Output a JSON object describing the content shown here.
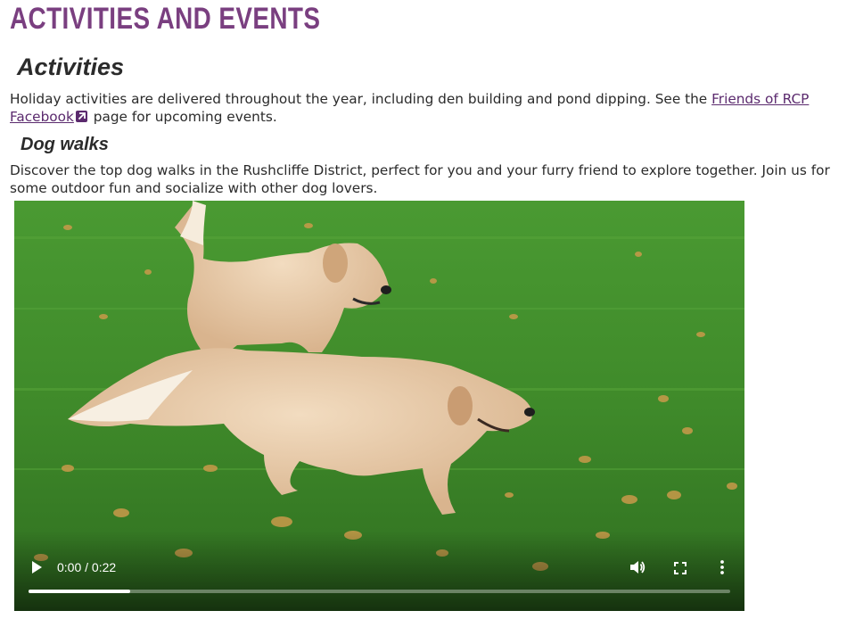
{
  "page": {
    "heading": "ACTIVITIES AND EVENTS"
  },
  "activities": {
    "heading": "Activities",
    "text_before_link": "Holiday activities are delivered throughout the year, including den building and pond dipping. See the ",
    "link_text": "Friends of RCP Facebook",
    "text_after_link": " page for upcoming events.",
    "link_icon": "external-link-icon"
  },
  "dog_walks": {
    "heading": "Dog walks",
    "text": "Discover the top dog walks in the Rushcliffe District, perfect for you and your furry friend to explore together. Join us for some outdoor fun and socialize with other dog lovers."
  },
  "video": {
    "time_display": "0:00 / 0:22",
    "current_time": "0:00",
    "duration": "0:22",
    "buffered_fraction": 0.145,
    "played_fraction": 0,
    "icons": {
      "play": "play-icon",
      "volume": "volume-icon",
      "fullscreen": "fullscreen-icon",
      "more": "more-options-icon"
    }
  },
  "colors": {
    "page_heading": "#7a3f80",
    "link": "#5b2a6e",
    "body_text": "#2b2b2b",
    "grass": "#3f8a2a"
  }
}
